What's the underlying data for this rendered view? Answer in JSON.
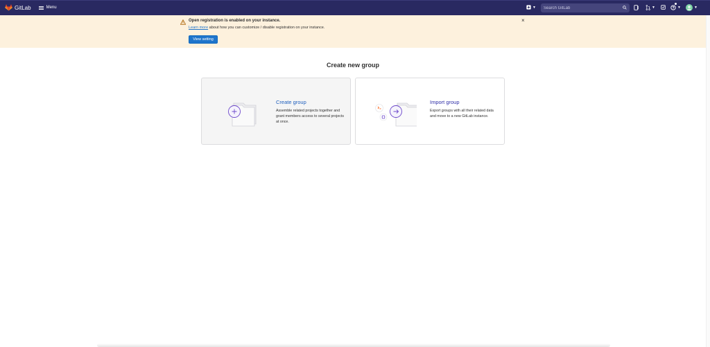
{
  "topbar": {
    "brand": "GitLab",
    "menu_label": "Menu",
    "search_placeholder": "Search GitLab",
    "icons": [
      "plus-square-icon",
      "issues-icon",
      "merge-request-icon",
      "todo-icon",
      "help-icon",
      "avatar"
    ]
  },
  "alert": {
    "title": "Open registration is enabled on your instance.",
    "link_text": "Learn more",
    "description": " about how you can customize / disable registration on your instance.",
    "button_label": "View setting",
    "close_label": "×"
  },
  "page": {
    "title": "Create new group",
    "cards": [
      {
        "title": "Create group",
        "description": "Assemble related projects together and grant members access to several projects at once.",
        "icon": "plus-circle-icon"
      },
      {
        "title": "Import group",
        "description": "Export groups with all their related data and move to a new GitLab instance.",
        "icon": "arrow-right-circle-icon"
      }
    ]
  },
  "colors": {
    "navbar": "#292961",
    "alert_bg": "#fdf1dd",
    "primary": "#1f75cb",
    "illustration_purple": "#6e49cb"
  }
}
